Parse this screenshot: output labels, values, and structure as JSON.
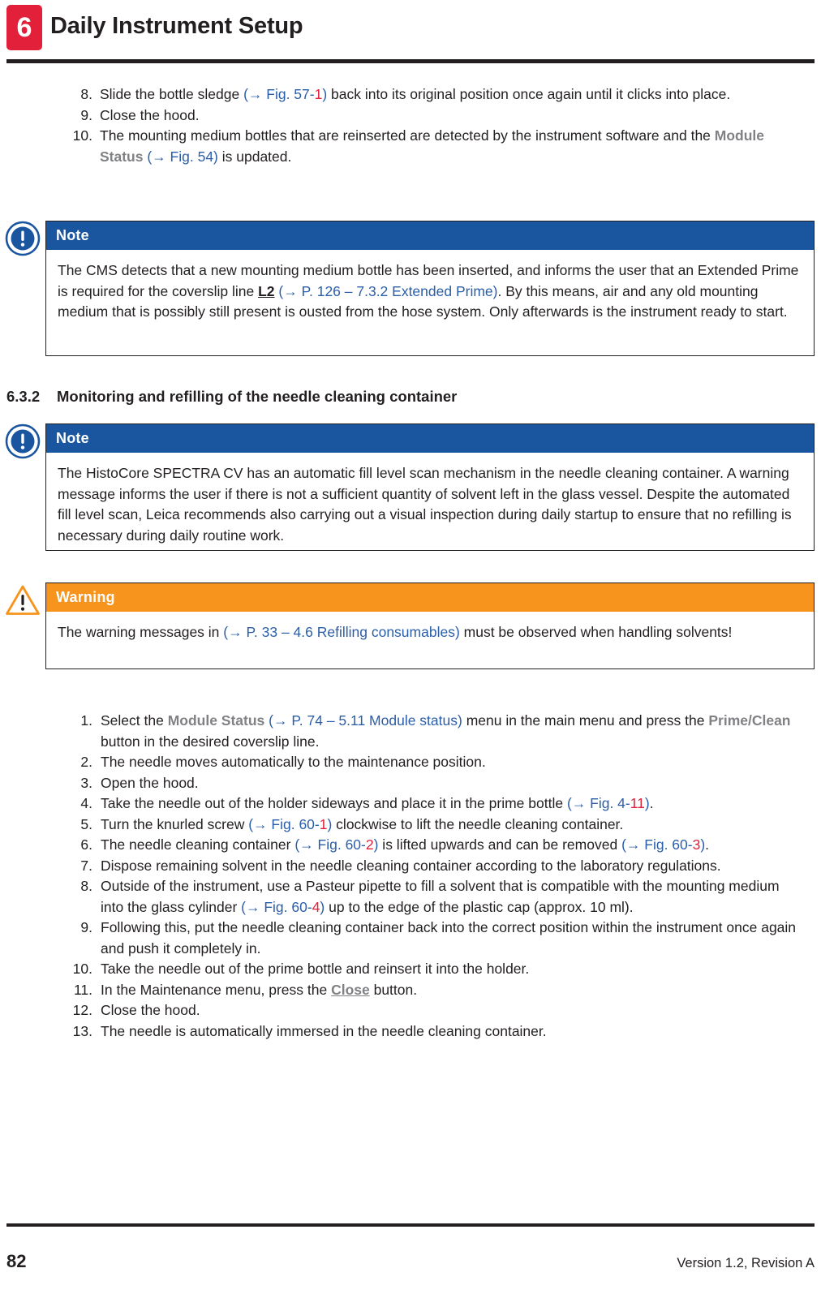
{
  "header": {
    "chapter_number": "6",
    "title": "Daily Instrument Setup"
  },
  "top_list": {
    "items": [
      {
        "num": "8.",
        "parts": [
          {
            "t": "Slide the bottle sledge ",
            "style": "plain"
          },
          {
            "t": "(→ Fig.  57-",
            "style": "xref"
          },
          {
            "t": "1",
            "style": "xref-num"
          },
          {
            "t": ")",
            "style": "xref"
          },
          {
            "t": " back into its original position once again until it clicks into place.",
            "style": "plain"
          }
        ]
      },
      {
        "num": "9.",
        "parts": [
          {
            "t": "Close the hood.",
            "style": "plain"
          }
        ]
      },
      {
        "num": "10.",
        "parts": [
          {
            "t": "The mounting medium bottles that are reinserted are detected by the instrument software and the ",
            "style": "plain"
          },
          {
            "t": "Module Status",
            "style": "ui-term"
          },
          {
            "t": " ",
            "style": "plain"
          },
          {
            "t": "(→ Fig.  54)",
            "style": "xref"
          },
          {
            "t": " is updated.",
            "style": "plain"
          }
        ]
      }
    ]
  },
  "note_1": {
    "label": "Note",
    "icon": "note-circle-exclamation-icon",
    "parts": [
      {
        "t": "The CMS detects that a new mounting medium bottle has been inserted, and informs the user that an Extended Prime is required for the coverslip line ",
        "style": "plain"
      },
      {
        "t": "L2",
        "style": "kbd-link"
      },
      {
        "t": " ",
        "style": "plain"
      },
      {
        "t": "(→ P. 126 – 7.3.2 Extended Prime)",
        "style": "xref"
      },
      {
        "t": ". By this means, air and any old mounting medium that is possibly still present is ousted from the hose system. Only afterwards is the instrument ready to start.",
        "style": "plain"
      }
    ]
  },
  "section": {
    "number": "6.3.2",
    "title": "Monitoring and refilling of the needle cleaning container"
  },
  "note_2": {
    "label": "Note",
    "icon": "note-circle-exclamation-icon",
    "parts": [
      {
        "t": "The HistoCore SPECTRA CV has an automatic fill level scan mechanism in the needle cleaning container. A warning message informs the user if there is not a sufficient quantity of solvent left in the glass vessel. Despite the automated fill level scan, Leica recommends also carrying out a visual inspection during daily startup to ensure that no refilling is necessary during daily routine work.",
        "style": "plain"
      }
    ]
  },
  "warning_1": {
    "label": "Warning",
    "icon": "warning-triangle-exclamation-icon",
    "parts": [
      {
        "t": "The warning messages in ",
        "style": "plain"
      },
      {
        "t": "(→ P. 33 – 4.6 Refilling consumables)",
        "style": "xref"
      },
      {
        "t": " must be observed when handling solvents!",
        "style": "plain"
      }
    ]
  },
  "main_list": {
    "items": [
      {
        "num": "1.",
        "parts": [
          {
            "t": "Select the ",
            "style": "plain"
          },
          {
            "t": "Module Status",
            "style": "ui-term"
          },
          {
            "t": " ",
            "style": "plain"
          },
          {
            "t": "(→ P. 74 – 5.11 Module status)",
            "style": "xref"
          },
          {
            "t": " menu in the main menu and press the ",
            "style": "plain"
          },
          {
            "t": "Prime/Clean",
            "style": "ui-term"
          },
          {
            "t": " button in the desired coverslip line.",
            "style": "plain"
          }
        ]
      },
      {
        "num": "2.",
        "parts": [
          {
            "t": "The needle moves automatically to the maintenance position.",
            "style": "plain"
          }
        ]
      },
      {
        "num": "3.",
        "parts": [
          {
            "t": "Open the hood.",
            "style": "plain"
          }
        ]
      },
      {
        "num": "4.",
        "parts": [
          {
            "t": "Take the needle out of the holder sideways and place it in the prime bottle ",
            "style": "plain"
          },
          {
            "t": "(→ Fig.  4-",
            "style": "xref"
          },
          {
            "t": "11",
            "style": "xref-num"
          },
          {
            "t": ")",
            "style": "xref"
          },
          {
            "t": ".",
            "style": "plain"
          }
        ]
      },
      {
        "num": "5.",
        "parts": [
          {
            "t": "Turn the knurled screw ",
            "style": "plain"
          },
          {
            "t": "(→ Fig.  60-",
            "style": "xref"
          },
          {
            "t": "1",
            "style": "xref-num"
          },
          {
            "t": ")",
            "style": "xref"
          },
          {
            "t": " clockwise to lift the needle cleaning container.",
            "style": "plain"
          }
        ]
      },
      {
        "num": "6.",
        "parts": [
          {
            "t": "The needle cleaning container ",
            "style": "plain"
          },
          {
            "t": "(→ Fig.  60-",
            "style": "xref"
          },
          {
            "t": "2",
            "style": "xref-num"
          },
          {
            "t": ")",
            "style": "xref"
          },
          {
            "t": " is lifted upwards and can be removed ",
            "style": "plain"
          },
          {
            "t": "(→ Fig.  60-",
            "style": "xref"
          },
          {
            "t": "3",
            "style": "xref-num"
          },
          {
            "t": ")",
            "style": "xref"
          },
          {
            "t": ".",
            "style": "plain"
          }
        ]
      },
      {
        "num": "7.",
        "parts": [
          {
            "t": "Dispose remaining solvent in the needle cleaning container according to the laboratory regulations.",
            "style": "plain"
          }
        ]
      },
      {
        "num": "8.",
        "parts": [
          {
            "t": "Outside of the instrument, use a Pasteur pipette to fill a solvent that is compatible with the mounting medium into the glass cylinder ",
            "style": "plain"
          },
          {
            "t": "(→ Fig.  60-",
            "style": "xref"
          },
          {
            "t": "4",
            "style": "xref-num"
          },
          {
            "t": ")",
            "style": "xref"
          },
          {
            "t": " up to the edge of the plastic cap (approx. 10 ml).",
            "style": "plain"
          }
        ]
      },
      {
        "num": "9.",
        "parts": [
          {
            "t": "Following this, put the needle cleaning container back into the correct position within the instrument once again and push it completely in.",
            "style": "plain"
          }
        ]
      },
      {
        "num": "10.",
        "parts": [
          {
            "t": "Take the needle out of the prime bottle and reinsert it into the holder.",
            "style": "plain"
          }
        ]
      },
      {
        "num": "11.",
        "parts": [
          {
            "t": "In the Maintenance menu, press the ",
            "style": "plain"
          },
          {
            "t": "Close",
            "style": "kbd-link-gray"
          },
          {
            "t": " button.",
            "style": "plain"
          }
        ]
      },
      {
        "num": "12.",
        "parts": [
          {
            "t": "Close the hood.",
            "style": "plain"
          }
        ]
      },
      {
        "num": "13.",
        "parts": [
          {
            "t": "The needle is automatically immersed in the needle cleaning container.",
            "style": "plain"
          }
        ]
      }
    ]
  },
  "footer": {
    "page_number": "82",
    "version": "Version 1.2, Revision A"
  },
  "colors": {
    "chapter_red": "#e3203a",
    "note_blue": "#1a569f",
    "warning_orange": "#f7941d",
    "xref_blue": "#2b5ea9",
    "xref_red": "#e3203a",
    "ui_term_gray": "#808184",
    "text_black": "#231f20"
  }
}
